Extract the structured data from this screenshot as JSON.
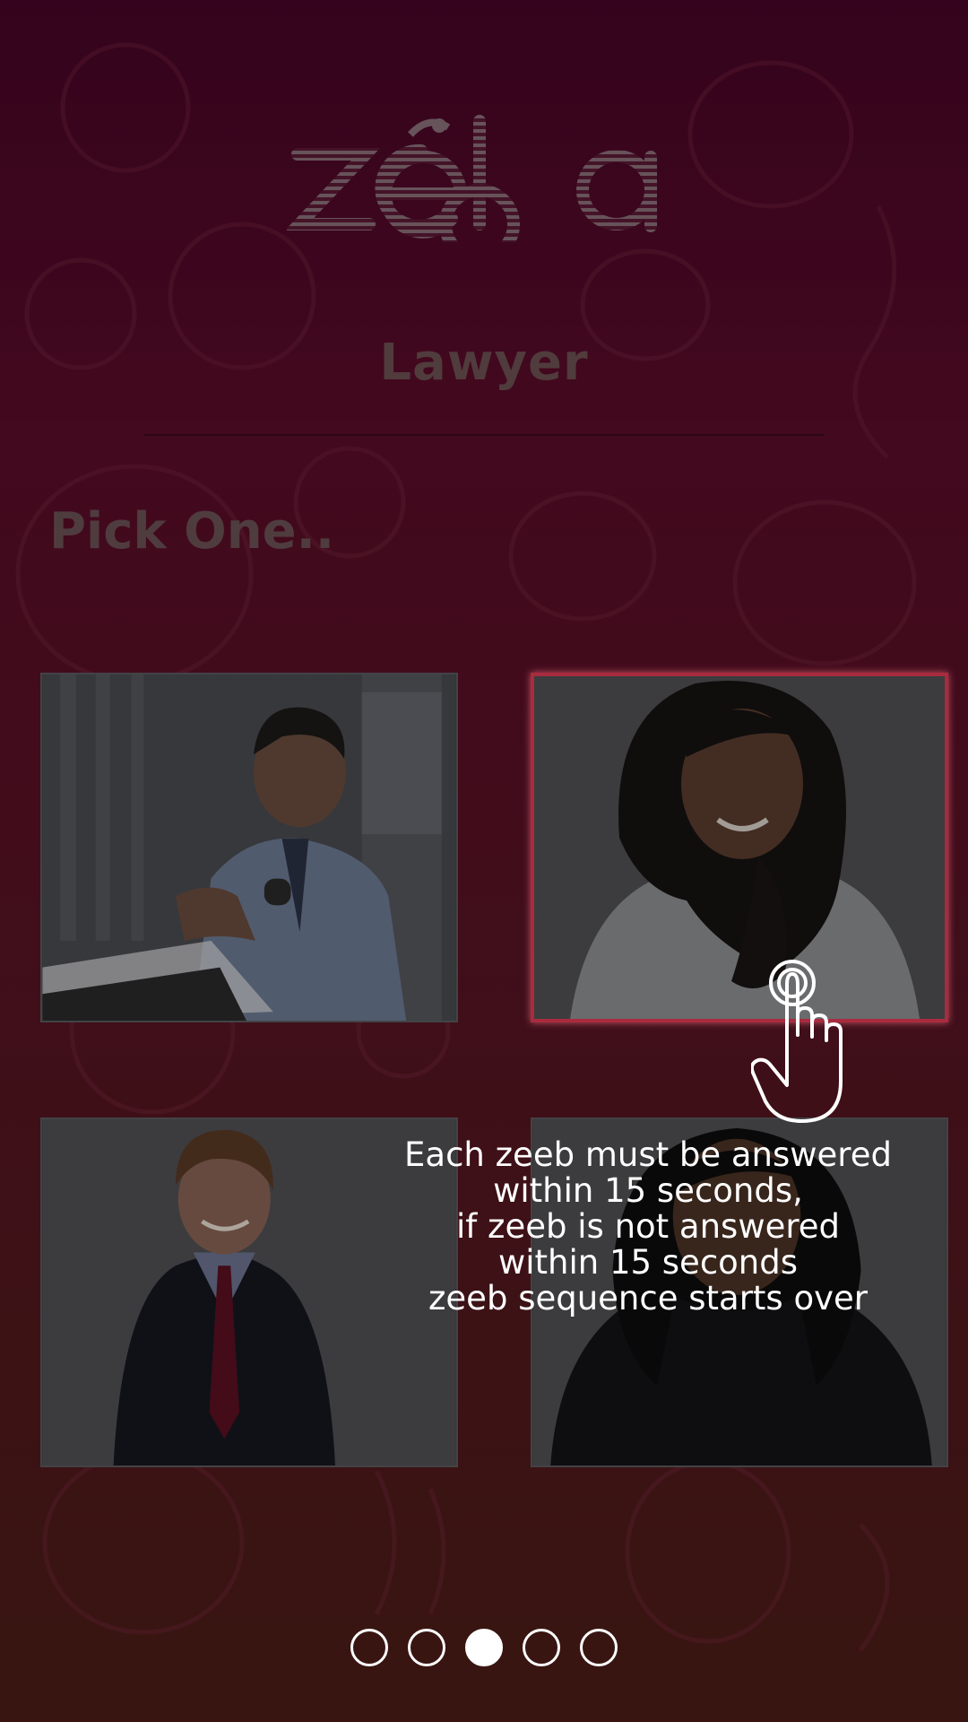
{
  "header": {
    "logo_text": "zeeba",
    "category_title": "Lawyer"
  },
  "prompt": {
    "text": "Pick One.."
  },
  "choices": [
    {
      "name": "man-with-laptop",
      "selected": false
    },
    {
      "name": "woman-white-top",
      "selected": true
    },
    {
      "name": "man-in-suit",
      "selected": false
    },
    {
      "name": "woman-dark-top",
      "selected": false
    }
  ],
  "tooltip": {
    "lines": [
      "Each zeeb must be answered",
      "within 15 seconds,",
      "if zeeb is not answered",
      "within 15 seconds",
      "zeeb sequence starts over"
    ]
  },
  "pagination": {
    "total": 5,
    "active_index": 2
  },
  "icons": {
    "tap": "tap-hand-icon"
  },
  "colors": {
    "background_top": "#470527",
    "background_bottom": "#4b1d16",
    "selection_border": "#e23a55",
    "text_muted": "#6b4f52"
  }
}
